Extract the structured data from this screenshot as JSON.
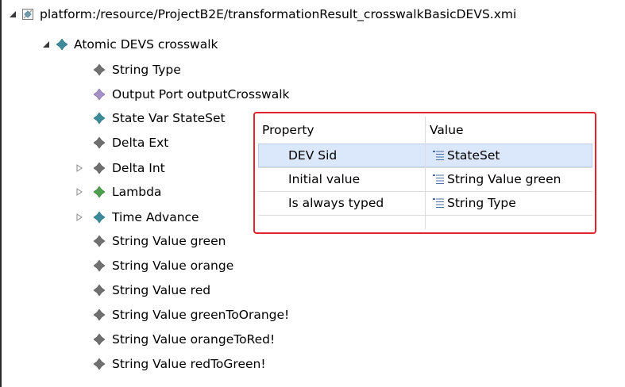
{
  "colors": {
    "frame_border": "#2b2b2b",
    "highlight_border": "#e8202a",
    "selection_bg": "#dbe8fb",
    "diamond_teal": "#3d8b9a",
    "diamond_gray": "#707070",
    "diamond_purple": "#a590c8",
    "diamond_green": "#4fa04f"
  },
  "tree": {
    "root": {
      "label": "platform:/resource/ProjectB2E/transformationResult_crosswalkBasicDEVS.xmi",
      "icon": "xmi-resource-icon",
      "state": "expanded"
    },
    "model": {
      "label": "Atomic DEVS crosswalk",
      "icon": "teal-diamond-icon",
      "state": "expanded"
    },
    "children": [
      {
        "label": "String Type",
        "icon": "gray-diamond-icon",
        "state": "leaf"
      },
      {
        "label": "Output Port outputCrosswalk",
        "icon": "purple-diamond-icon",
        "state": "leaf"
      },
      {
        "label": "State Var StateSet",
        "icon": "teal-diamond-icon",
        "state": "leaf"
      },
      {
        "label": "Delta Ext",
        "icon": "gray-diamond-icon",
        "state": "leaf"
      },
      {
        "label": "Delta Int",
        "icon": "gray-diamond-icon",
        "state": "collapsed"
      },
      {
        "label": "Lambda",
        "icon": "green-diamond-icon",
        "state": "collapsed"
      },
      {
        "label": "Time Advance",
        "icon": "teal-diamond-icon",
        "state": "collapsed"
      },
      {
        "label": "String Value green",
        "icon": "gray-diamond-icon",
        "state": "leaf"
      },
      {
        "label": "String Value orange",
        "icon": "gray-diamond-icon",
        "state": "leaf"
      },
      {
        "label": "String Value red",
        "icon": "gray-diamond-icon",
        "state": "leaf"
      },
      {
        "label": "String Value greenToOrange!",
        "icon": "gray-diamond-icon",
        "state": "leaf"
      },
      {
        "label": "String Value orangeToRed!",
        "icon": "gray-diamond-icon",
        "state": "leaf"
      },
      {
        "label": "String Value redToGreen!",
        "icon": "gray-diamond-icon",
        "state": "leaf"
      }
    ]
  },
  "properties": {
    "headers": {
      "property": "Property",
      "value": "Value"
    },
    "rows": [
      {
        "property": "DEV Sid",
        "value": "StateSet",
        "selected": true
      },
      {
        "property": "Initial value",
        "value": "String Value green",
        "selected": false
      },
      {
        "property": "Is always typed",
        "value": "String Type",
        "selected": false
      }
    ]
  }
}
